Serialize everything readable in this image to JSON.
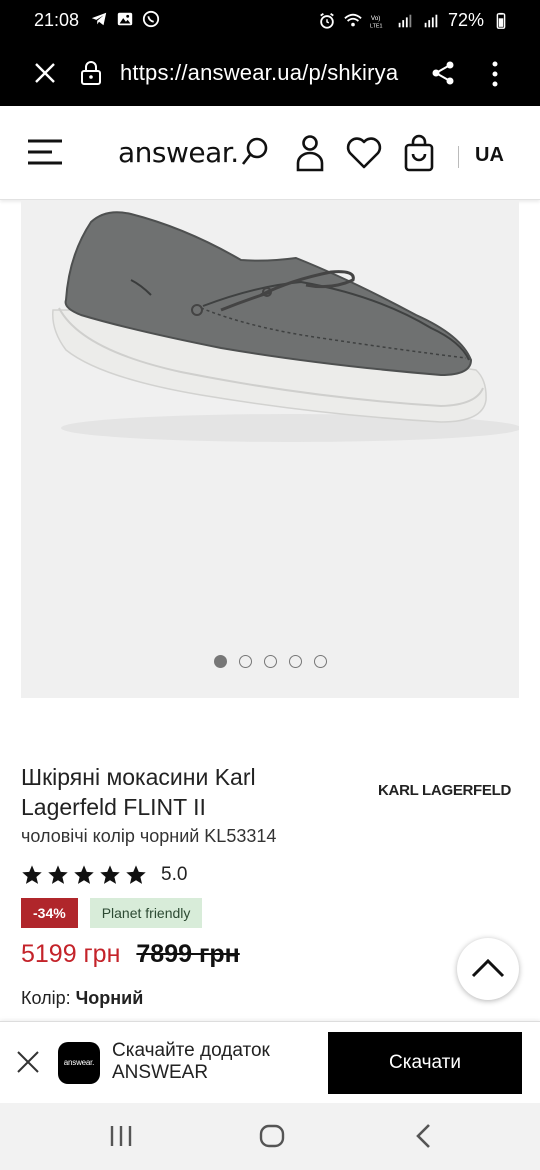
{
  "status_bar": {
    "time": "21:08",
    "battery": "72%",
    "left_icons": [
      "telegram-icon",
      "gallery-icon",
      "viber-icon"
    ],
    "right_icons": [
      "alarm-icon",
      "wifi-icon",
      "volte-icon",
      "signal-icon",
      "signal-icon",
      "battery-icon"
    ]
  },
  "browser": {
    "url": "https://answear.ua/p/shkirya"
  },
  "header": {
    "logo": "answear.",
    "lang": "UA"
  },
  "gallery": {
    "slide_count": 5,
    "active_slide": 1
  },
  "product": {
    "title": "Шкіряні мокасини Karl Lagerfeld FLINT II",
    "brand": "KARL LAGERFELD",
    "subtitle": "чоловічі колір чорний KL53314",
    "rating_value": "5.0",
    "stars": 5,
    "discount_badge": "-34%",
    "eco_badge": "Planet friendly",
    "price_new": "5199 грн",
    "price_old": "7899 грн",
    "color_label": "Колір:",
    "color_value": "Чорний"
  },
  "app_banner": {
    "app_icon_text": "answear.",
    "text_line1": "Скачайте додаток",
    "text_line2": "ANSWEAR",
    "download_label": "Скачати"
  },
  "colors": {
    "price_red": "#c4232a",
    "discount_bg": "#b0262b",
    "eco_bg": "#d8ecd9"
  }
}
